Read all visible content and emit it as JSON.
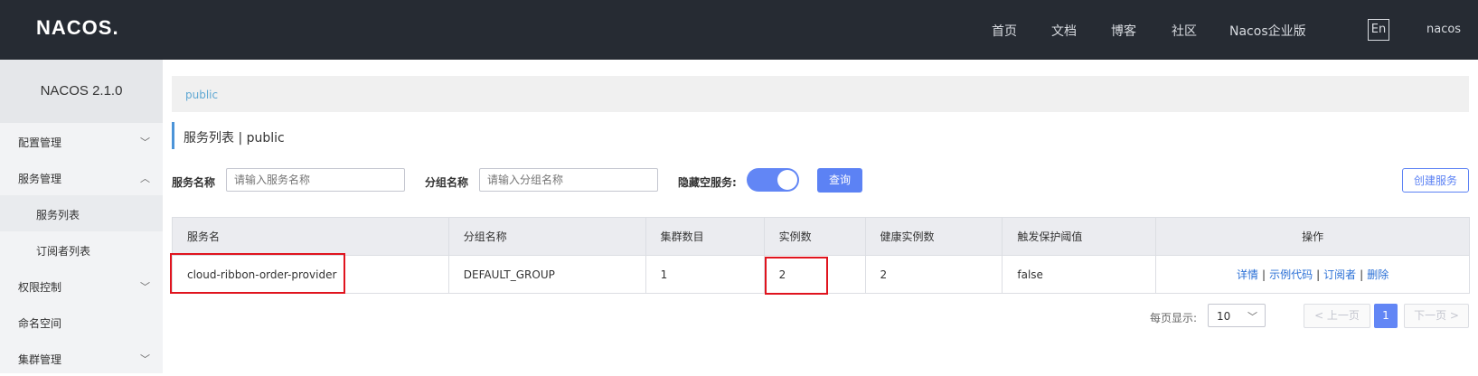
{
  "header": {
    "logo": "NACOS.",
    "nav": [
      "首页",
      "文档",
      "博客",
      "社区",
      "Nacos企业版"
    ],
    "lang": "En",
    "user": "nacos"
  },
  "sidebar": {
    "version": "NACOS 2.1.0",
    "items": [
      {
        "label": "配置管理",
        "chevron": "⌵"
      },
      {
        "label": "服务管理",
        "chevron": "^"
      },
      {
        "label": "服务列表"
      },
      {
        "label": "订阅者列表"
      },
      {
        "label": "权限控制",
        "chevron": "⌵"
      },
      {
        "label": "命名空间"
      },
      {
        "label": "集群管理",
        "chevron": "⌵"
      }
    ]
  },
  "breadcrumb": "public",
  "page_title": "服务列表 | public",
  "filters": {
    "service_name_label": "服务名称",
    "service_name_placeholder": "请输入服务名称",
    "group_name_label": "分组名称",
    "group_name_placeholder": "请输入分组名称",
    "hide_empty_label": "隐藏空服务:",
    "hide_empty_on": true,
    "query_button": "查询",
    "create_button": "创建服务"
  },
  "table": {
    "columns": [
      "服务名",
      "分组名称",
      "集群数目",
      "实例数",
      "健康实例数",
      "触发保护阈值",
      "操作"
    ],
    "rows": [
      {
        "service": "cloud-ribbon-order-provider",
        "group": "DEFAULT_GROUP",
        "clusters": "1",
        "instances": "2",
        "healthy": "2",
        "threshold": "false",
        "ops": [
          "详情",
          "示例代码",
          "订阅者",
          "删除"
        ]
      }
    ]
  },
  "pagination": {
    "page_size_label": "每页显示:",
    "page_size": "10",
    "prev": "< 上一页",
    "current": "1",
    "next": "下一页 >"
  },
  "colors": {
    "topbar": "#262b33",
    "primary": "#5c82f4",
    "highlight_box": "#e0141e"
  }
}
